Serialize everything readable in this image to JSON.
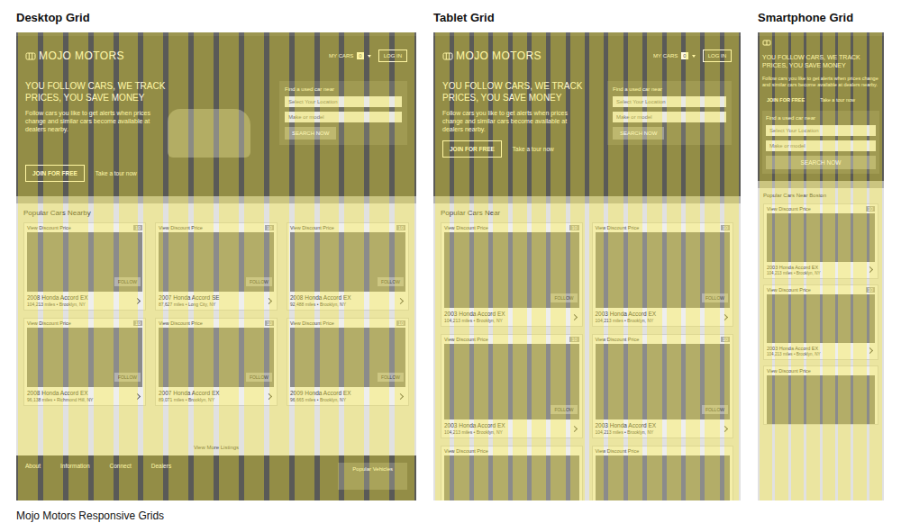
{
  "caption": "Mojo Motors Responsive Grids",
  "grids": [
    {
      "title": "Desktop Grid",
      "kind": "desktop",
      "header": {
        "logo": "MOJO MOTORS",
        "my_cars": "MY CARS",
        "count": "0",
        "login": "LOG IN"
      },
      "hero": {
        "headline": "YOU FOLLOW CARS, WE TRACK PRICES, YOU SAVE MONEY",
        "body": "Follow cars you like to get alerts when prices change and similar cars become available at dealers nearby.",
        "join": "JOIN FOR FREE",
        "tour": "Take a tour now"
      },
      "search": {
        "label": "Find a used car near",
        "location": "Select Your Location",
        "model": "Make or model",
        "button": "SEARCH NOW"
      },
      "listings": {
        "title": "Popular Cars Nearby",
        "more": "View More Listings",
        "cards": [
          {
            "price": "View Discount Price",
            "count": "10",
            "name": "2008 Honda Accord EX",
            "meta": "104,213 miles • Brooklyn, NY",
            "follow": "FOLLOW"
          },
          {
            "price": "View Discount Price",
            "count": "10",
            "name": "2007 Honda Accord SE",
            "meta": "87,627 miles • Long City, NY",
            "follow": "FOLLOW"
          },
          {
            "price": "View Discount Price",
            "count": "10",
            "name": "2008 Honda Accord EX",
            "meta": "92,488 miles • Brooklyn, NY",
            "follow": "FOLLOW"
          },
          {
            "price": "View Discount Price",
            "count": "10",
            "name": "2008 Honda Accord EX",
            "meta": "96,138 miles • Richmond Hill, NY",
            "follow": "FOLLOW"
          },
          {
            "price": "View Discount Price",
            "count": "10",
            "name": "2007 Honda Accord EX",
            "meta": "89,071 miles • Brooklyn, NY",
            "follow": "FOLLOW"
          },
          {
            "price": "View Discount Price",
            "count": "10",
            "name": "2009 Honda Accord EX",
            "meta": "96,665 miles • Brooklyn, NY",
            "follow": "FOLLOW"
          }
        ]
      },
      "footer": {
        "links": [
          "About",
          "Information",
          "Connect",
          "Dealers"
        ],
        "popular": "Popular Vehicles"
      }
    },
    {
      "title": "Tablet Grid",
      "kind": "tablet",
      "header": {
        "logo": "MOJO MOTORS",
        "my_cars": "MY CARS",
        "count": "0",
        "login": "LOG IN"
      },
      "hero": {
        "headline": "YOU FOLLOW CARS, WE TRACK PRICES, YOU SAVE MONEY",
        "body": "Follow cars you like to get alerts when prices change and similar cars become available at dealers nearby.",
        "join": "JOIN FOR FREE",
        "tour": "Take a tour now"
      },
      "search": {
        "label": "Find a used car near",
        "location": "Select Your Location",
        "model": "Make or model",
        "button": "SEARCH NOW"
      },
      "listings": {
        "title": "Popular Cars Near",
        "cards": [
          {
            "price": "View Discount Price",
            "count": "10",
            "name": "2003 Honda Accord EX",
            "meta": "104,213 miles • Brooklyn, NY",
            "follow": "FOLLOW"
          },
          {
            "price": "View Discount Price",
            "count": "10",
            "name": "2003 Honda Accord EX",
            "meta": "104,213 miles • Brooklyn, NY",
            "follow": "FOLLOW"
          },
          {
            "price": "View Discount Price",
            "count": "10",
            "name": "2003 Honda Accord EX",
            "meta": "104,213 miles • Brooklyn, NY",
            "follow": "FOLLOW"
          },
          {
            "price": "View Discount Price",
            "count": "10",
            "name": "2003 Honda Accord EX",
            "meta": "104,213 miles • Brooklyn, NY",
            "follow": "FOLLOW"
          },
          {
            "price": "View Discount Price"
          },
          {
            "price": "View Discount Price"
          }
        ]
      }
    },
    {
      "title": "Smartphone Grid",
      "kind": "smartphone",
      "hero": {
        "headline": "YOU FOLLOW CARS, WE TRACK PRICES, YOU SAVE MONEY",
        "body": "Follow cars you like to get alerts when prices change and similar cars become available at dealers nearby.",
        "join": "JOIN FOR FREE",
        "tour": "Take a tour now"
      },
      "search": {
        "label": "Find a used car near",
        "location": "Select Your Location",
        "model": "Make or model",
        "button": "SEARCH NOW"
      },
      "listings": {
        "title": "Popular Cars Near Boston",
        "cards": [
          {
            "price": "View Discount Price",
            "count": "10",
            "name": "2003 Honda Accord EX",
            "meta": "104,213 miles • Brooklyn, NY"
          },
          {
            "price": "View Discount Price",
            "count": "10",
            "name": "2003 Honda Accord EX",
            "meta": "104,213 miles • Brooklyn, NY"
          },
          {
            "price": "View Discount Price"
          }
        ]
      }
    }
  ]
}
